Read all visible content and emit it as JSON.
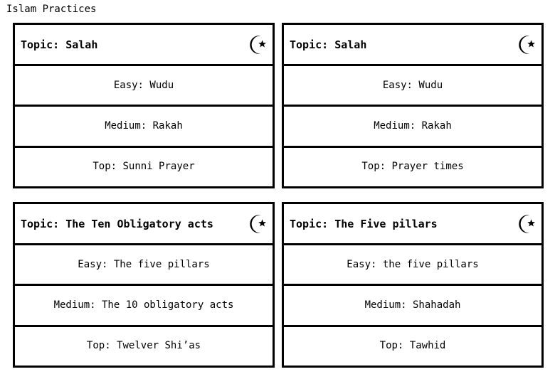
{
  "page": {
    "title": "Islam Practices"
  },
  "icon": {
    "name": "star-and-crescent-icon",
    "glyph": "☪",
    "color": "#000000"
  },
  "theme": {
    "border_color": "#000000",
    "background_color": "#ffffff",
    "text_color": "#000000"
  },
  "cards": [
    {
      "title": "Topic: Salah",
      "rows": [
        "Easy: Wudu",
        "Medium: Rakah",
        "Top: Sunni Prayer"
      ]
    },
    {
      "title": "Topic: Salah",
      "rows": [
        "Easy: Wudu",
        "Medium: Rakah",
        "Top: Prayer times"
      ]
    },
    {
      "title": "Topic: The Ten Obligatory acts",
      "rows": [
        "Easy: The five pillars",
        "Medium: The 10 obligatory acts",
        "Top: Twelver Shi’as"
      ]
    },
    {
      "title": "Topic: The Five pillars",
      "rows": [
        "Easy: the five pillars",
        "Medium: Shahadah",
        "Top: Tawhid"
      ]
    }
  ]
}
